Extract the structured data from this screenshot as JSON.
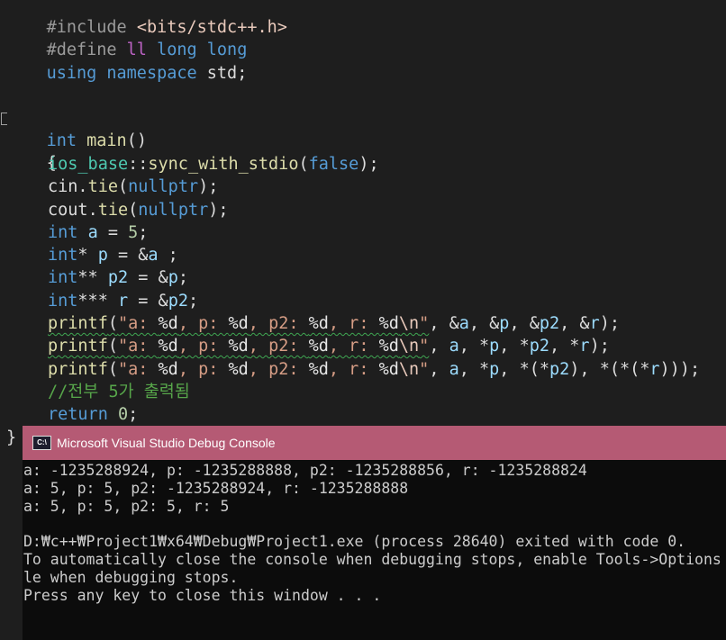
{
  "editor": {
    "line0_text": "#include <bits/stdc++.h>",
    "define_kw": "#define",
    "define_name": "ll",
    "define_val": "long long",
    "using_kw": "using namespace",
    "std": "std",
    "int_kw": "int",
    "main_fn": "main",
    "main_params": "()",
    "open_brace": "{",
    "close_brace": "}",
    "ios_base": "ios_base",
    "sync_fn": "sync_with_stdio",
    "false_kw": "false",
    "cin": "cin",
    "cout": "cout",
    "tie_fn": "tie",
    "nullptr_kw": "nullptr",
    "comment": "//전부 5가 출력됨",
    "return_kw": "return",
    "zero": "0",
    "five": "5",
    "printf": "printf",
    "fmt_str_a": "\"a: %d, p: %d, p2: %d, r: %d",
    "fmt_escape": "\\n",
    "fmt_quote": "\""
  },
  "console": {
    "title": "Microsoft Visual Studio Debug Console",
    "icon_label": "C:\\",
    "lines": [
      "a: -1235288924, p: -1235288888, p2: -1235288856, r: -1235288824",
      "a: 5, p: 5, p2: -1235288924, r: -1235288888",
      "a: 5, p: 5, p2: 5, r: 5",
      "",
      "D:₩c++₩Project1₩x64₩Debug₩Project1.exe (process 28640) exited with code 0.",
      "To automatically close the console when debugging stops, enable Tools->Options",
      "le when debugging stops.",
      "Press any key to close this window . . ."
    ]
  }
}
